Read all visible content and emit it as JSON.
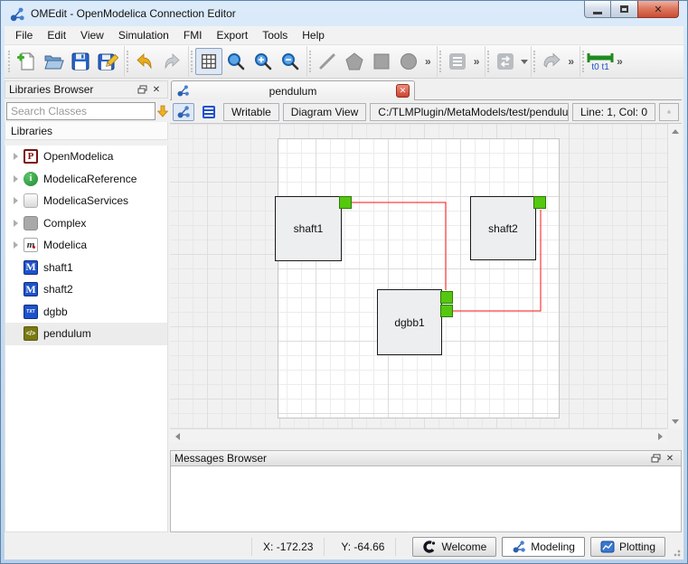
{
  "window": {
    "title": "OMEdit - OpenModelica Connection Editor"
  },
  "menu": {
    "items": [
      "File",
      "Edit",
      "View",
      "Simulation",
      "FMI",
      "Export",
      "Tools",
      "Help"
    ]
  },
  "toolbar": {
    "overflow": "»",
    "t0t1_label": "t0 t1"
  },
  "libraries": {
    "dock_title": "Libraries Browser",
    "search_placeholder": "Search Classes",
    "tree_header": "Libraries",
    "items": [
      {
        "label": "OpenModelica",
        "glyph": "P"
      },
      {
        "label": "ModelicaReference",
        "glyph": "i"
      },
      {
        "label": "ModelicaServices",
        "glyph": ""
      },
      {
        "label": "Complex",
        "glyph": ""
      },
      {
        "label": "Modelica",
        "glyph": "m"
      },
      {
        "label": "shaft1",
        "glyph": "M"
      },
      {
        "label": "shaft2",
        "glyph": "M"
      },
      {
        "label": "dgbb",
        "glyph": "TXT"
      },
      {
        "label": "pendulum",
        "glyph": "</>"
      }
    ]
  },
  "editor": {
    "tab_title": "pendulum",
    "writable_label": "Writable",
    "view_label": "Diagram View",
    "file_path": "C:/TLMPlugin/MetaModels/test/pendulum.xml",
    "cursor_position": "Line: 1, Col: 0"
  },
  "diagram": {
    "components": [
      {
        "name": "shaft1"
      },
      {
        "name": "shaft2"
      },
      {
        "name": "dgbb1"
      }
    ]
  },
  "messages": {
    "dock_title": "Messages Browser"
  },
  "statusbar": {
    "x_coordinate": "X: -172.23",
    "y_coordinate": "Y: -64.66",
    "perspectives": [
      {
        "label": "Welcome"
      },
      {
        "label": "Modeling"
      },
      {
        "label": "Plotting"
      }
    ]
  },
  "colors": {
    "connection_line": "#ff1010",
    "connector_fill": "#54c80e",
    "titlebar_blue": "#c6dbf2",
    "model_icon_blue": "#1e52cc"
  }
}
